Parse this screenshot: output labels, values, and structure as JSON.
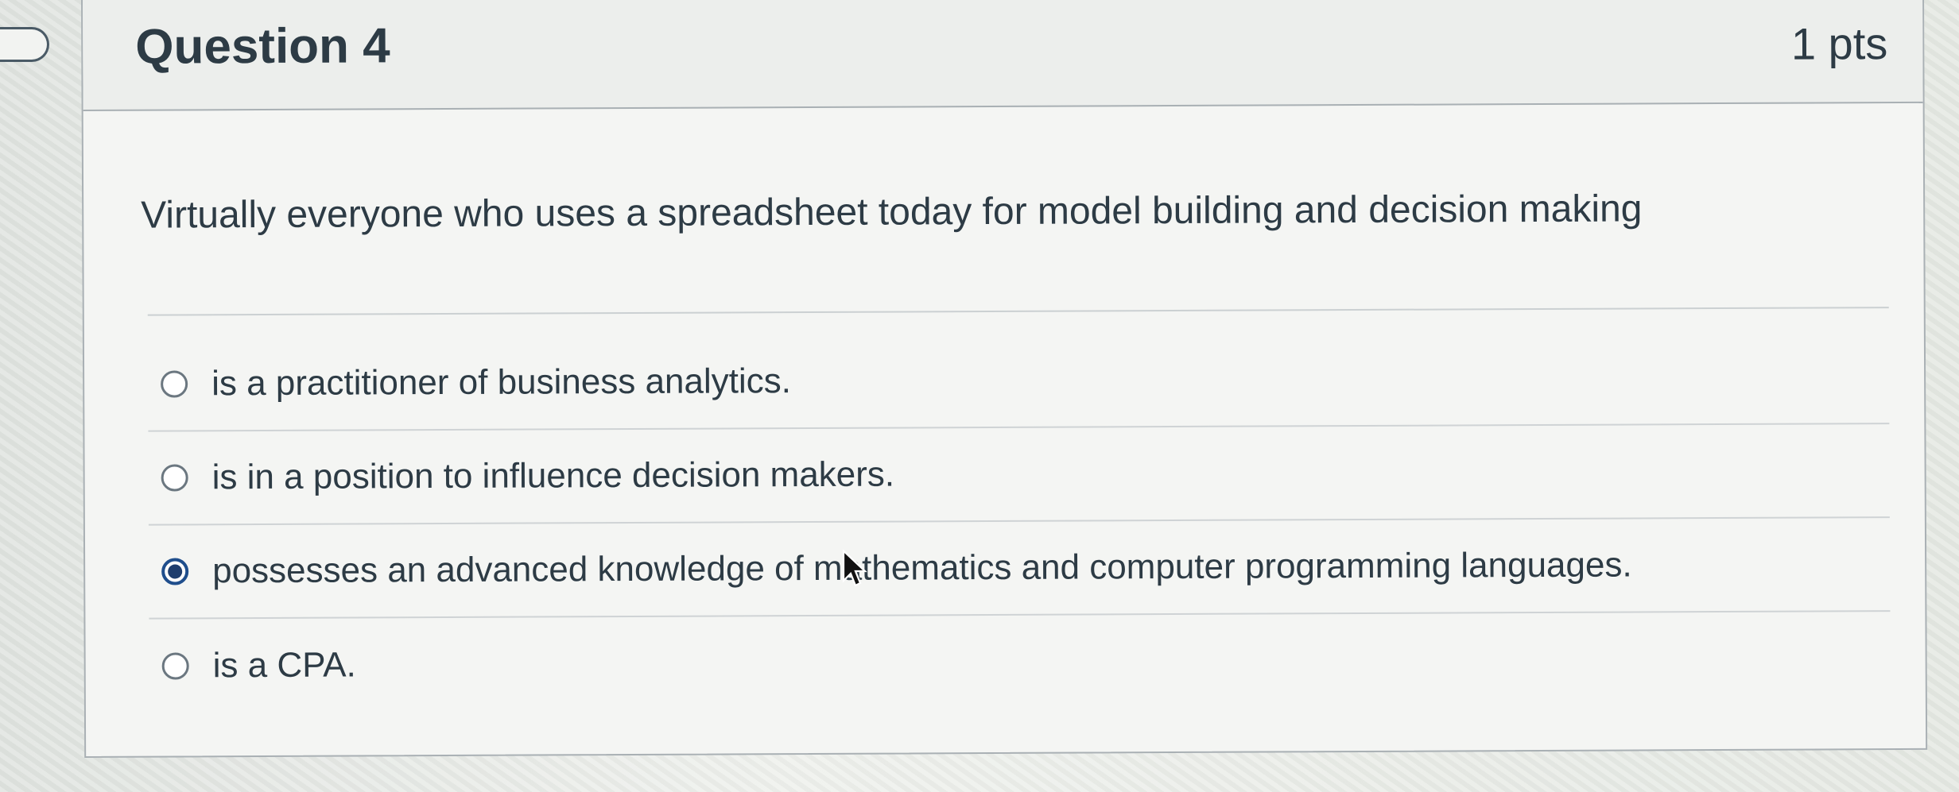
{
  "question": {
    "title": "Question 4",
    "points": "1 pts",
    "text": "Virtually everyone who uses a spreadsheet today for model building and decision making"
  },
  "answers": [
    {
      "label": "is a practitioner of business analytics.",
      "selected": false
    },
    {
      "label": "is in a position to influence decision makers.",
      "selected": false
    },
    {
      "label": "possesses an advanced knowledge of mathematics and computer programming languages.",
      "selected": true
    },
    {
      "label": "is a CPA.",
      "selected": false
    }
  ],
  "icons": {
    "nav": "bookmark-flag-icon",
    "radio_empty": "radio-unselected-icon",
    "radio_selected": "radio-selected-icon",
    "cursor": "mouse-pointer-icon"
  },
  "colors": {
    "text": "#2d3b45",
    "selected_radio": "#1f4e8c",
    "border": "#a9b0b4"
  }
}
